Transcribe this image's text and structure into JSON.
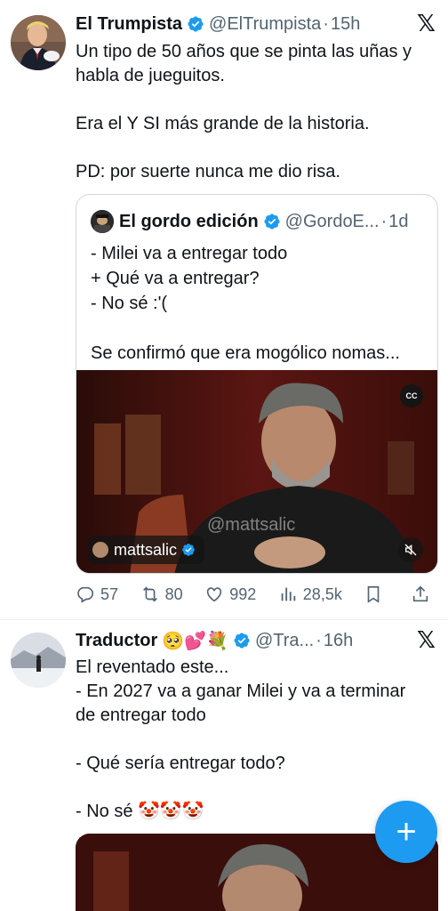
{
  "tweet1": {
    "name": "El Trumpista",
    "handle": "@ElTrumpista",
    "separator": "·",
    "time": "15h",
    "x_logo": "𝕏",
    "lines": [
      "Un tipo de 50 años que se pinta las uñas y",
      "habla de jueguitos.",
      "",
      "Era el Y SI más grande de la historia.",
      "",
      "PD: por suerte nunca me dio risa."
    ]
  },
  "quote": {
    "name": "El gordo edición",
    "handle": "@GordoE...",
    "separator": "·",
    "time": "1d",
    "lines": [
      "- Milei va a entregar todo",
      "+ Qué va a entregar?",
      "- No sé :'(",
      "",
      "Se confirmó que era mogólico nomas..."
    ],
    "video": {
      "cc_label": "CC",
      "watermark": "@mattsalic",
      "creator": "mattsalic"
    }
  },
  "actions": {
    "replies": "57",
    "retweets": "80",
    "likes": "992",
    "views": "28,5k"
  },
  "tweet2": {
    "name": "Traductor",
    "emojis": "🥺💕💐",
    "handle": "@Tra...",
    "separator": "·",
    "time": "16h",
    "x_logo": "𝕏",
    "lines": [
      "El reventado este...",
      "- En 2027 va a ganar Milei y va a terminar",
      "de entregar todo",
      "",
      "- Qué sería entregar todo?",
      "",
      "- No sé 🤡🤡🤡"
    ]
  },
  "fab": {
    "label": "+"
  },
  "colors": {
    "accent": "#1d9bf0",
    "text": "#0f1419",
    "muted": "#536471",
    "border": "#cfd9de"
  }
}
